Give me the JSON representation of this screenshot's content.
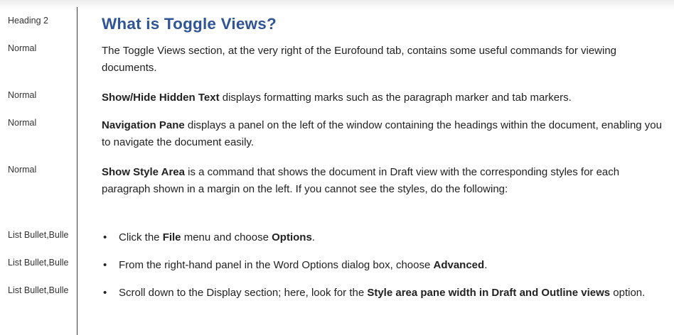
{
  "style_area": {
    "labels": [
      "Heading 2",
      "Normal",
      "Normal",
      "Normal",
      "Normal",
      "List Bullet,Bulle",
      "List Bullet,Bulle",
      "List Bullet,Bulle"
    ]
  },
  "doc": {
    "heading": "What is Toggle Views?",
    "p1": "The Toggle Views section, at the very right of the Eurofound tab, contains some useful commands for viewing documents.",
    "p2": {
      "bold": "Show/Hide Hidden Text",
      "rest": " displays formatting marks such as the paragraph marker and tab markers."
    },
    "p3": {
      "bold": "Navigation Pane",
      "rest": " displays a panel on the left of the window containing the headings within the document, enabling you to navigate the document easily."
    },
    "p4": {
      "bold": "Show Style Area",
      "rest": " is a command that shows the document in Draft view with the corresponding styles for each paragraph shown in a margin on the left. If you cannot see the styles, do the following:"
    },
    "bullets": [
      {
        "t1": "Click the ",
        "b1": "File",
        "t2": " menu and choose ",
        "b2": "Options",
        "t3": "."
      },
      {
        "t1": "From the right-hand panel in the Word Options dialog box, choose ",
        "b1": "Advanced",
        "t2": ".",
        "b2": "",
        "t3": ""
      },
      {
        "t1": "Scroll down to the Display section; here, look for the ",
        "b1": "Style area pane width in Draft and Outline views",
        "t2": " option.",
        "b2": "",
        "t3": ""
      }
    ],
    "bullet_glyph": "•"
  }
}
